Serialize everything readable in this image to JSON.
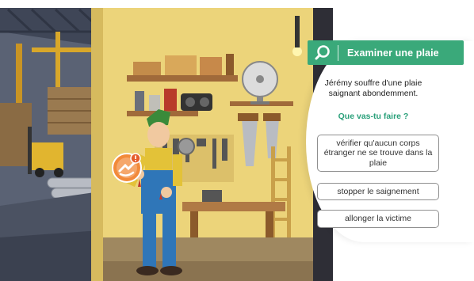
{
  "panel": {
    "title": "Examiner une plaie",
    "prompt": "Jérémy souffre d'une plaie saignant abondemment.",
    "question": "Que vas-tu faire ?",
    "answers": [
      "vérifier qu'aucun corps étranger ne se trouve dans la plaie",
      "stopper le saignement",
      "allonger la victime"
    ]
  },
  "colors": {
    "accent": "#3aa97a",
    "question_text": "#2aa07a",
    "workshop_wall": "#ecd47a",
    "alert": "#f28a3a"
  },
  "icons": {
    "header": "search-icon",
    "alert": "cut-hand-alert-icon"
  }
}
